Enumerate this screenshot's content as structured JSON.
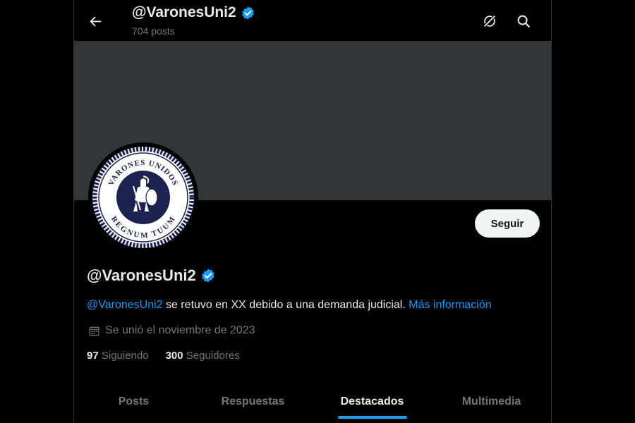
{
  "header": {
    "handle": "@VaronesUni2",
    "posts_count": "704 posts"
  },
  "icons": {
    "back": "arrow-left-icon",
    "verified": "verified-badge-icon",
    "grok": "grok-icon",
    "search": "search-icon",
    "calendar": "calendar-icon"
  },
  "avatar": {
    "logo_text_top": "VARONES UNIDOS",
    "logo_text_bottom": "REGNUM TUUM"
  },
  "follow_button": {
    "label": "Seguir"
  },
  "profile": {
    "handle": "@VaronesUni2",
    "bio_mention": "@VaronesUni2",
    "bio_text": " se retuvo en XX debido a una demanda judicial. ",
    "bio_link": "Más información",
    "joined": "Se unió el noviembre de 2023"
  },
  "stats": {
    "following_count": "97",
    "following_label": "Siguiendo",
    "followers_count": "300",
    "followers_label": "Seguidores"
  },
  "tabs": [
    {
      "label": "Posts"
    },
    {
      "label": "Respuestas"
    },
    {
      "label": "Destacados"
    },
    {
      "label": "Multimedia"
    }
  ],
  "active_tab": "Destacados",
  "colors": {
    "accent": "#1d9bf0",
    "background": "#000000",
    "banner": "#333639",
    "muted_text": "#71767b",
    "logo_navy": "#1c2350"
  }
}
